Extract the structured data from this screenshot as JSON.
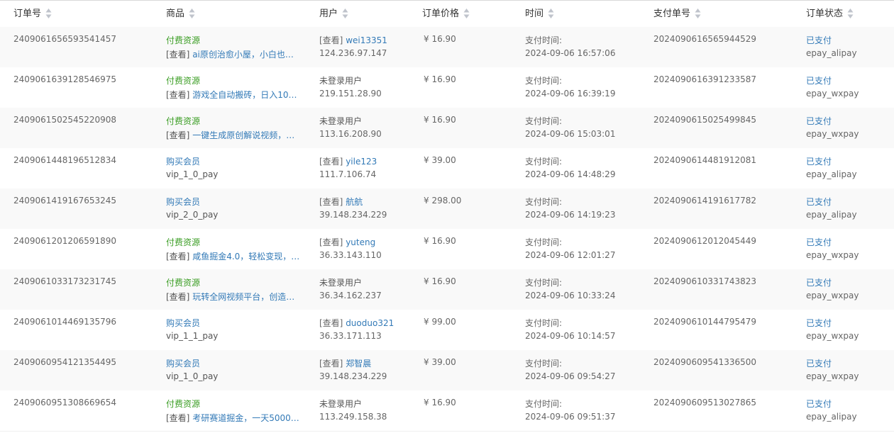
{
  "header": {
    "order_no": "订单号",
    "product": "商品",
    "user": "用户",
    "price": "订单价格",
    "time": "时间",
    "pay_no": "支付单号",
    "status": "订单状态"
  },
  "rows": [
    {
      "order_no": "2409061656593541457",
      "product_type": "付费资源",
      "product_detail": "[查看] ai原创治愈小屋，小白也…",
      "user_prefix": "[查看] ",
      "user_name": "wei13351",
      "ip": "124.236.97.147",
      "price": "¥ 16.90",
      "time_label": "支付时间:",
      "time": "2024-09-06 16:57:06",
      "pay_no": "2024090616565944529",
      "status": "已支付",
      "channel": "epay_alipay"
    },
    {
      "order_no": "2409061639128546975",
      "product_type": "付费资源",
      "product_detail": "[查看] 游戏全自动搬砖，日入10…",
      "user_prefix": "",
      "user_name": "未登录用户",
      "ip": "219.151.28.90",
      "price": "¥ 16.90",
      "time_label": "支付时间:",
      "time": "2024-09-06 16:39:19",
      "pay_no": "2024090616391233587",
      "status": "已支付",
      "channel": "epay_wxpay"
    },
    {
      "order_no": "2409061502545220908",
      "product_type": "付费资源",
      "product_detail": "[查看] 一键生成原创解说视频，…",
      "user_prefix": "",
      "user_name": "未登录用户",
      "ip": "113.16.208.90",
      "price": "¥ 16.90",
      "time_label": "支付时间:",
      "time": "2024-09-06 15:03:01",
      "pay_no": "2024090615025499845",
      "status": "已支付",
      "channel": "epay_wxpay"
    },
    {
      "order_no": "2409061448196512834",
      "product_type": "购买会员",
      "product_detail": "vip_1_0_pay",
      "user_prefix": "[查看] ",
      "user_name": "yile123",
      "ip": "111.7.106.74",
      "price": "¥ 39.00",
      "time_label": "支付时间:",
      "time": "2024-09-06 14:48:29",
      "pay_no": "2024090614481912081",
      "status": "已支付",
      "channel": "epay_alipay"
    },
    {
      "order_no": "2409061419167653245",
      "product_type": "购买会员",
      "product_detail": "vip_2_0_pay",
      "user_prefix": "[查看] ",
      "user_name": "航航",
      "ip": "39.148.234.229",
      "price": "¥ 298.00",
      "time_label": "支付时间:",
      "time": "2024-09-06 14:19:23",
      "pay_no": "2024090614191617782",
      "status": "已支付",
      "channel": "epay_alipay"
    },
    {
      "order_no": "2409061201206591890",
      "product_type": "付费资源",
      "product_detail": "[查看] 咸鱼掘金4.0，轻松变现，…",
      "user_prefix": "[查看] ",
      "user_name": "yuteng",
      "ip": "36.33.143.110",
      "price": "¥ 16.90",
      "time_label": "支付时间:",
      "time": "2024-09-06 12:01:27",
      "pay_no": "2024090612012045449",
      "status": "已支付",
      "channel": "epay_wxpay"
    },
    {
      "order_no": "2409061033173231745",
      "product_type": "付费资源",
      "product_detail": "[查看] 玩转全网视频平台，创造…",
      "user_prefix": "",
      "user_name": "未登录用户",
      "ip": "36.34.162.237",
      "price": "¥ 16.90",
      "time_label": "支付时间:",
      "time": "2024-09-06 10:33:24",
      "pay_no": "2024090610331743823",
      "status": "已支付",
      "channel": "epay_wxpay"
    },
    {
      "order_no": "2409061014469135796",
      "product_type": "购买会员",
      "product_detail": "vip_1_1_pay",
      "user_prefix": "[查看] ",
      "user_name": "duoduo321",
      "ip": "36.33.171.113",
      "price": "¥ 99.00",
      "time_label": "支付时间:",
      "time": "2024-09-06 10:14:57",
      "pay_no": "2024090610144795479",
      "status": "已支付",
      "channel": "epay_wxpay"
    },
    {
      "order_no": "2409060954121354495",
      "product_type": "购买会员",
      "product_detail": "vip_1_0_pay",
      "user_prefix": "[查看] ",
      "user_name": "郑智晨",
      "ip": "39.148.234.229",
      "price": "¥ 39.00",
      "time_label": "支付时间:",
      "time": "2024-09-06 09:54:27",
      "pay_no": "2024090609541336500",
      "status": "已支付",
      "channel": "epay_wxpay"
    },
    {
      "order_no": "2409060951308669654",
      "product_type": "付费资源",
      "product_detail": "[查看] 考研赛道掘金，一天5000…",
      "user_prefix": "",
      "user_name": "未登录用户",
      "ip": "113.249.158.38",
      "price": "¥ 16.90",
      "time_label": "支付时间:",
      "time": "2024-09-06 09:51:37",
      "pay_no": "2024090609513027865",
      "status": "已支付",
      "channel": "epay_alipay"
    }
  ],
  "colors": {
    "resource_green": "#3a9d23",
    "link_blue": "#337ab7",
    "text_gray": "#555555",
    "stripe": "#f9f9f9",
    "border": "#d8d8d8"
  },
  "icons": {
    "sort": "sort-icon"
  }
}
